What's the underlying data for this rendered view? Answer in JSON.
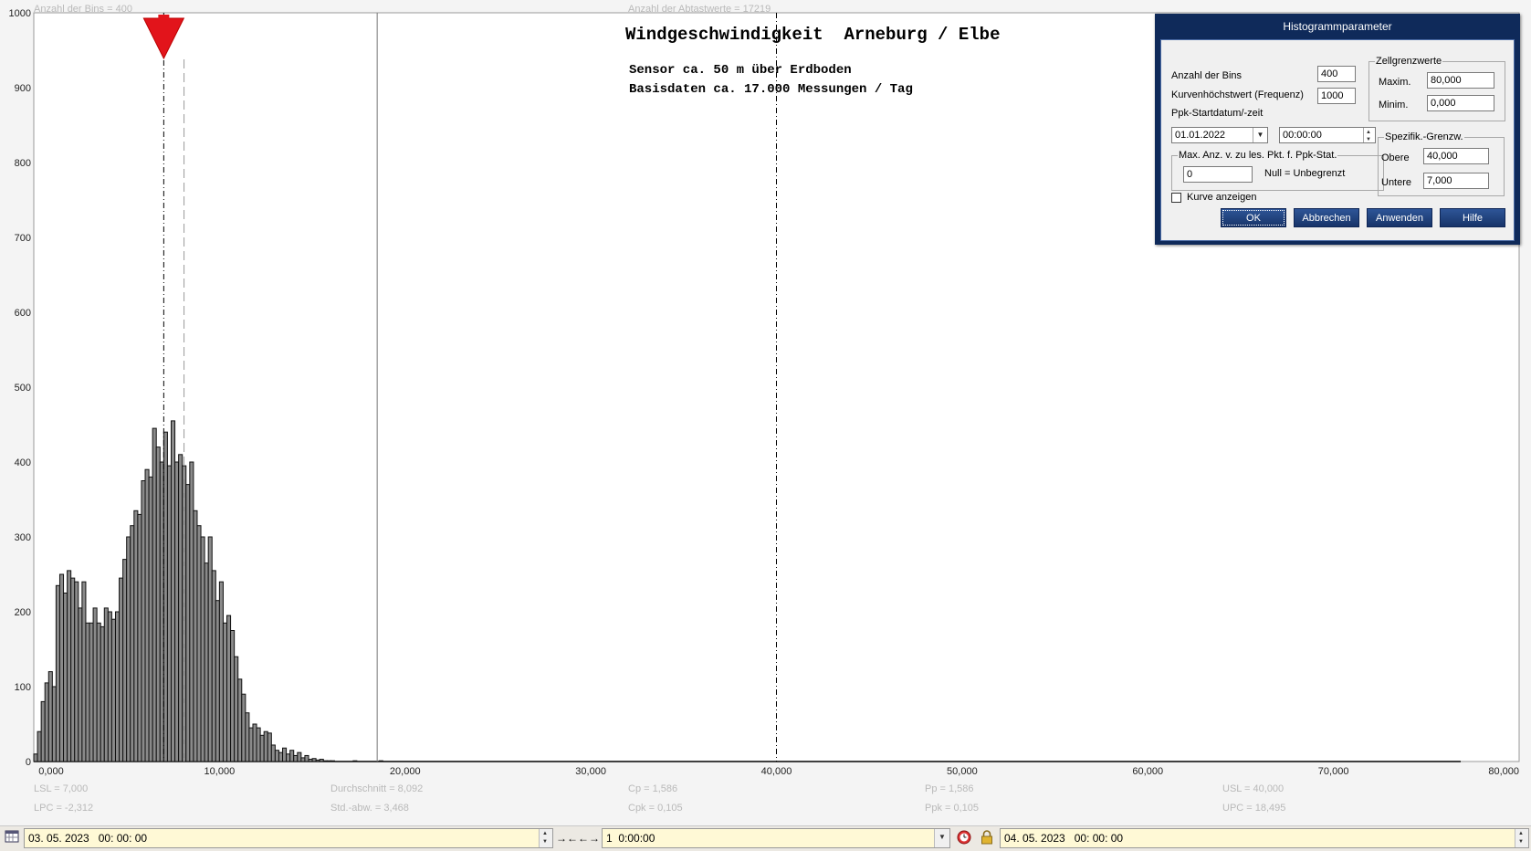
{
  "chart_data": {
    "type": "bar",
    "title": "Windgeschwindigkeit  Arneburg / Elbe",
    "subtitle_lines": [
      "Sensor ca. 50 m über Erdboden",
      "Basisdaten ca. 17.000 Messungen / Tag"
    ],
    "top_info": {
      "bins": "Anzahl der Bins =  400",
      "samples": "Anzahl der Abtastwerte = 17219"
    },
    "xlim": [
      0,
      80
    ],
    "ylim": [
      0,
      1000
    ],
    "x_ticks": [
      0,
      10,
      20,
      30,
      40,
      50,
      60,
      70,
      80
    ],
    "x_tick_labels": [
      "0,000",
      "10,000",
      "20,000",
      "30,000",
      "40,000",
      "50,000",
      "60,000",
      "70,000",
      "80,000"
    ],
    "y_ticks": [
      0,
      100,
      200,
      300,
      400,
      500,
      600,
      700,
      800,
      900,
      1000
    ],
    "y_tick_labels": [
      "0",
      "100",
      "200",
      "300",
      "400",
      "500",
      "600",
      "700",
      "800",
      "900",
      "1000"
    ],
    "bin_width": 0.2,
    "bin_start": 0.0,
    "values": [
      10,
      40,
      80,
      105,
      120,
      100,
      235,
      250,
      225,
      255,
      245,
      240,
      205,
      240,
      185,
      185,
      205,
      185,
      180,
      205,
      200,
      190,
      200,
      245,
      270,
      300,
      315,
      335,
      330,
      375,
      390,
      380,
      445,
      420,
      400,
      440,
      395,
      455,
      400,
      410,
      395,
      370,
      400,
      335,
      315,
      300,
      265,
      300,
      255,
      215,
      240,
      185,
      195,
      175,
      140,
      110,
      90,
      65,
      45,
      50,
      45,
      35,
      40,
      38,
      22,
      15,
      12,
      18,
      10,
      15,
      8,
      12,
      5,
      8,
      3,
      4,
      2,
      3,
      1,
      1,
      1,
      0,
      0,
      0,
      0,
      0,
      1,
      0,
      0,
      0,
      0,
      0,
      0,
      1,
      0,
      0,
      0,
      0,
      0,
      0
    ],
    "reference_lines": [
      {
        "name": "LSL",
        "x": 7.0,
        "style": "dash-dot"
      },
      {
        "name": "Durchschnitt",
        "x": 8.092,
        "style": "dashed"
      },
      {
        "name": "UPC",
        "x": 18.495,
        "style": "solid"
      },
      {
        "name": "USL",
        "x": 40.0,
        "style": "dash-dot"
      }
    ],
    "stats": {
      "col1": [
        "LSL = 7,000",
        "LPC = -2,312"
      ],
      "col2": [
        "Durchschnitt  = 8,092",
        "Std.-abw.  = 3,468"
      ],
      "col3": [
        "Cp  = 1,586",
        "Cpk = 0,105"
      ],
      "col4": [
        "Pp  = 1,586",
        "Ppk = 0,105"
      ],
      "col5": [
        "USL = 40,000",
        "UPC = 18,495"
      ]
    },
    "colors": {
      "bar": "#8a8a8a",
      "bar_edge": "#111111",
      "marker": "#e2141b"
    },
    "grid": false
  },
  "dialog": {
    "title": "Histogrammparameter",
    "bins_label": "Anzahl der Bins",
    "bins_value": "400",
    "curve_max_label": "Kurvenhöchstwert (Frequenz)",
    "curve_max_value": "1000",
    "ppk_start_label": "Ppk-Startdatum/-zeit",
    "ppk_date": "01.01.2022",
    "ppk_time": "00:00:00",
    "max_group_label": "Max. Anz. v. zu les. Pkt. f. Ppk-Stat.",
    "max_value": "0",
    "null_label": "Null = Unbegrenzt",
    "cell_group_label": "Zellgrenzwerte",
    "maxim_label": "Maxim.",
    "maxim_value": "80,000",
    "minim_label": "Minim.",
    "minim_value": "0,000",
    "spec_group_label": "Spezifik.-Grenzw.",
    "obere_label": "Obere",
    "obere_value": "40,000",
    "untere_label": "Untere",
    "untere_value": "7,000",
    "show_curve_label": "Kurve anzeigen",
    "show_curve_checked": false,
    "buttons": {
      "ok": "OK",
      "cancel": "Abbrechen",
      "apply": "Anwenden",
      "help": "Hilfe"
    }
  },
  "toolbar": {
    "start_datetime": "03. 05. 2023   00: 00: 00",
    "interval": "1  0:00:00",
    "end_datetime": "04. 05. 2023   00: 00: 00",
    "zoom_in_icon": "→←",
    "zoom_out_icon": "←→"
  }
}
